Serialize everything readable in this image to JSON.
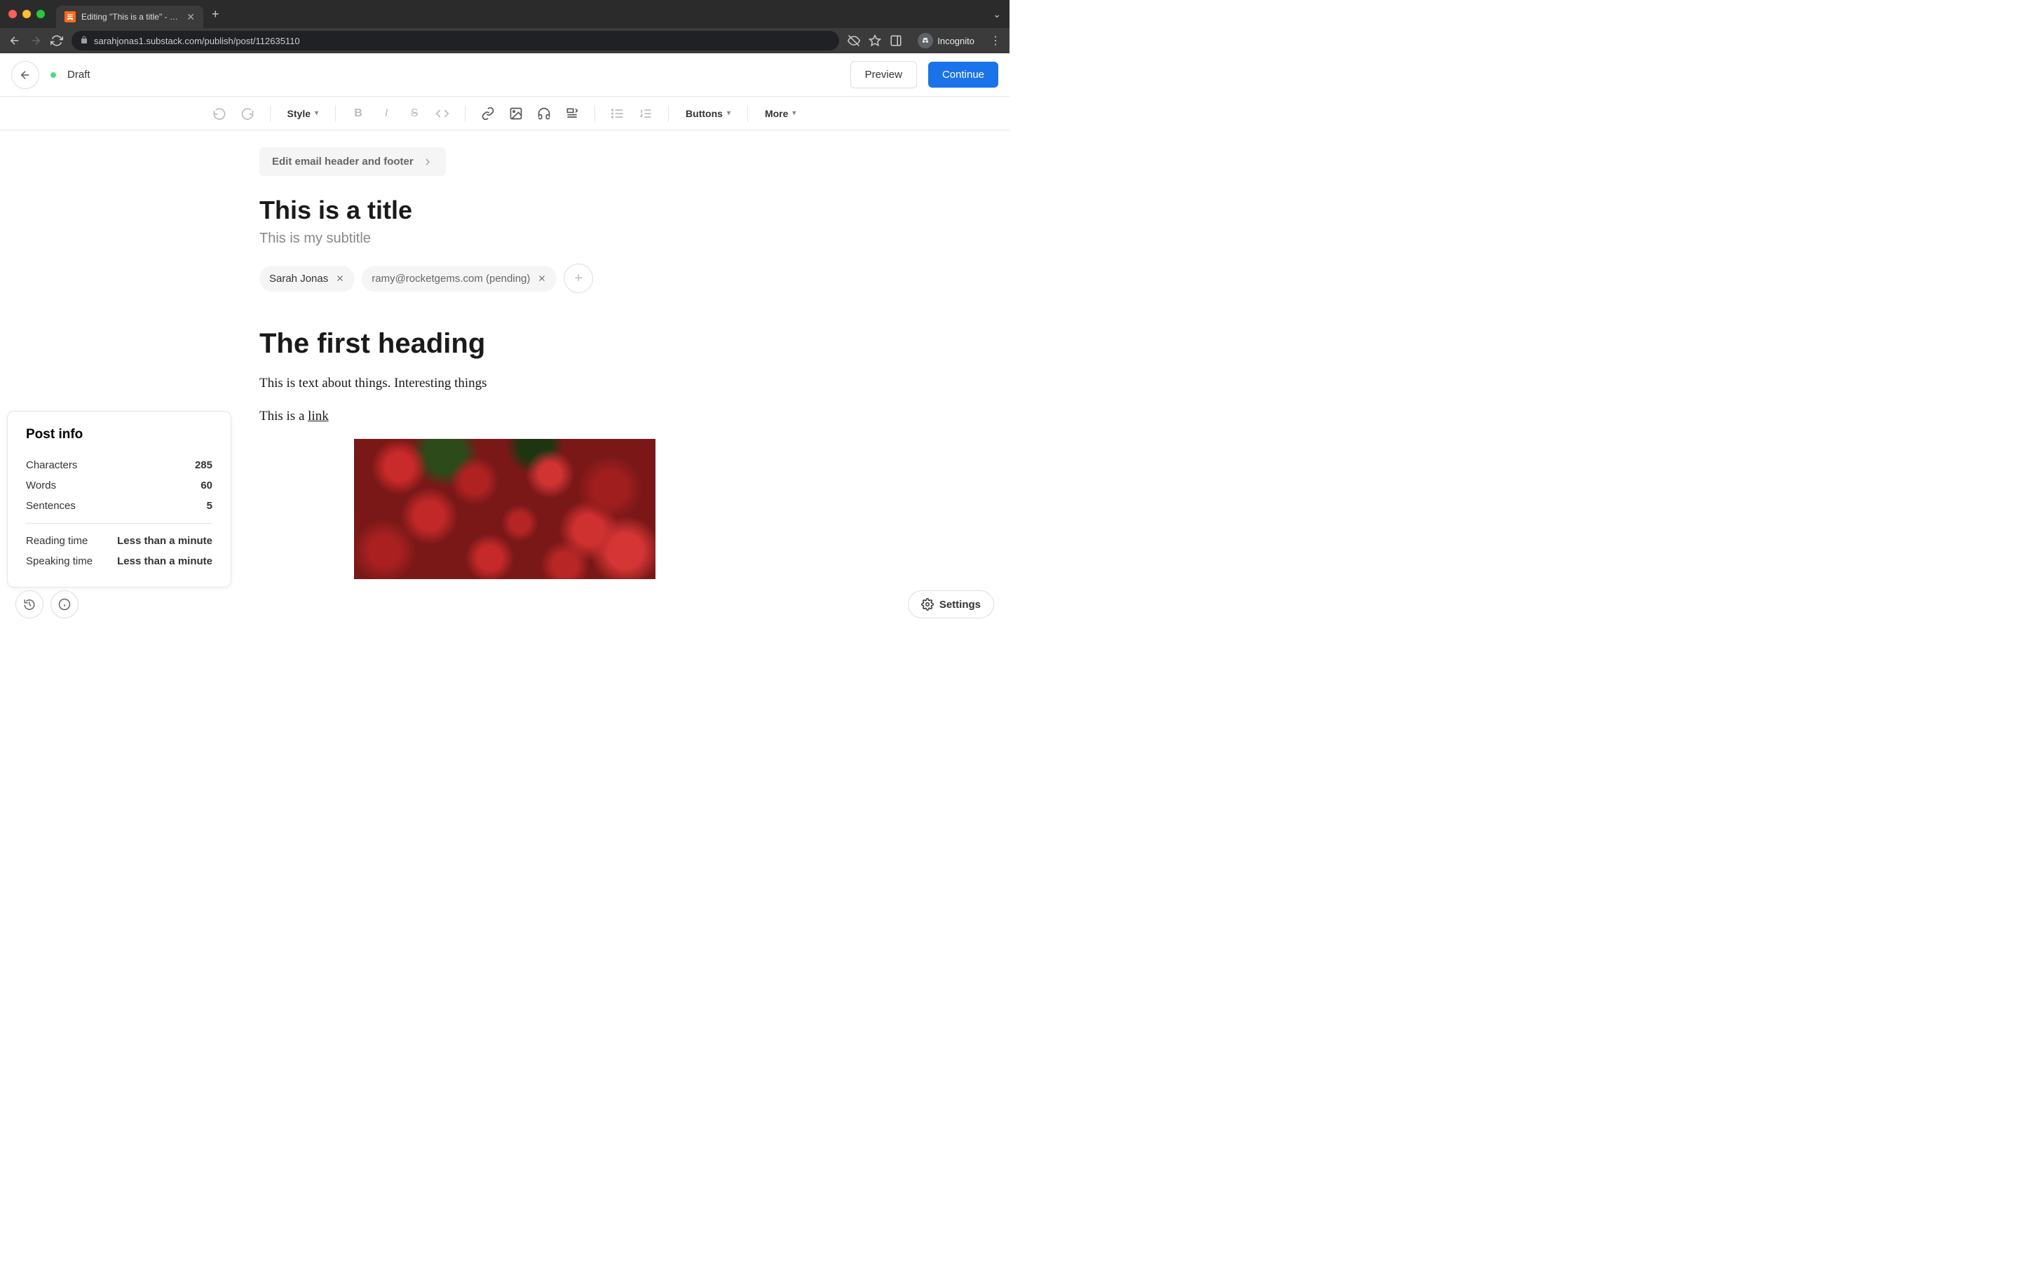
{
  "browser": {
    "tab_title": "Editing \"This is a title\" - Subst…",
    "url": "sarahjonas1.substack.com/publish/post/112635110",
    "incognito_label": "Incognito"
  },
  "header": {
    "status": "Draft",
    "preview_label": "Preview",
    "continue_label": "Continue"
  },
  "toolbar": {
    "style_label": "Style",
    "buttons_label": "Buttons",
    "more_label": "More"
  },
  "editor": {
    "email_header_button": "Edit email header and footer",
    "title": "This is a title",
    "subtitle": "This is my subtitle",
    "authors": [
      {
        "name": "Sarah Jonas",
        "pending": false
      },
      {
        "name": "ramy@rocketgems.com (pending)",
        "pending": true
      }
    ],
    "heading": "The first heading",
    "paragraph1": "This is text about things. Interesting things",
    "paragraph2_prefix": "This is a ",
    "paragraph2_link_text": "link "
  },
  "post_info": {
    "title": "Post info",
    "rows": [
      {
        "label": "Characters",
        "value": "285"
      },
      {
        "label": "Words",
        "value": "60"
      },
      {
        "label": "Sentences",
        "value": "5"
      }
    ],
    "rows2": [
      {
        "label": "Reading time",
        "value": "Less than a minute"
      },
      {
        "label": "Speaking time",
        "value": "Less than a minute"
      }
    ]
  },
  "footer": {
    "settings_label": "Settings"
  }
}
